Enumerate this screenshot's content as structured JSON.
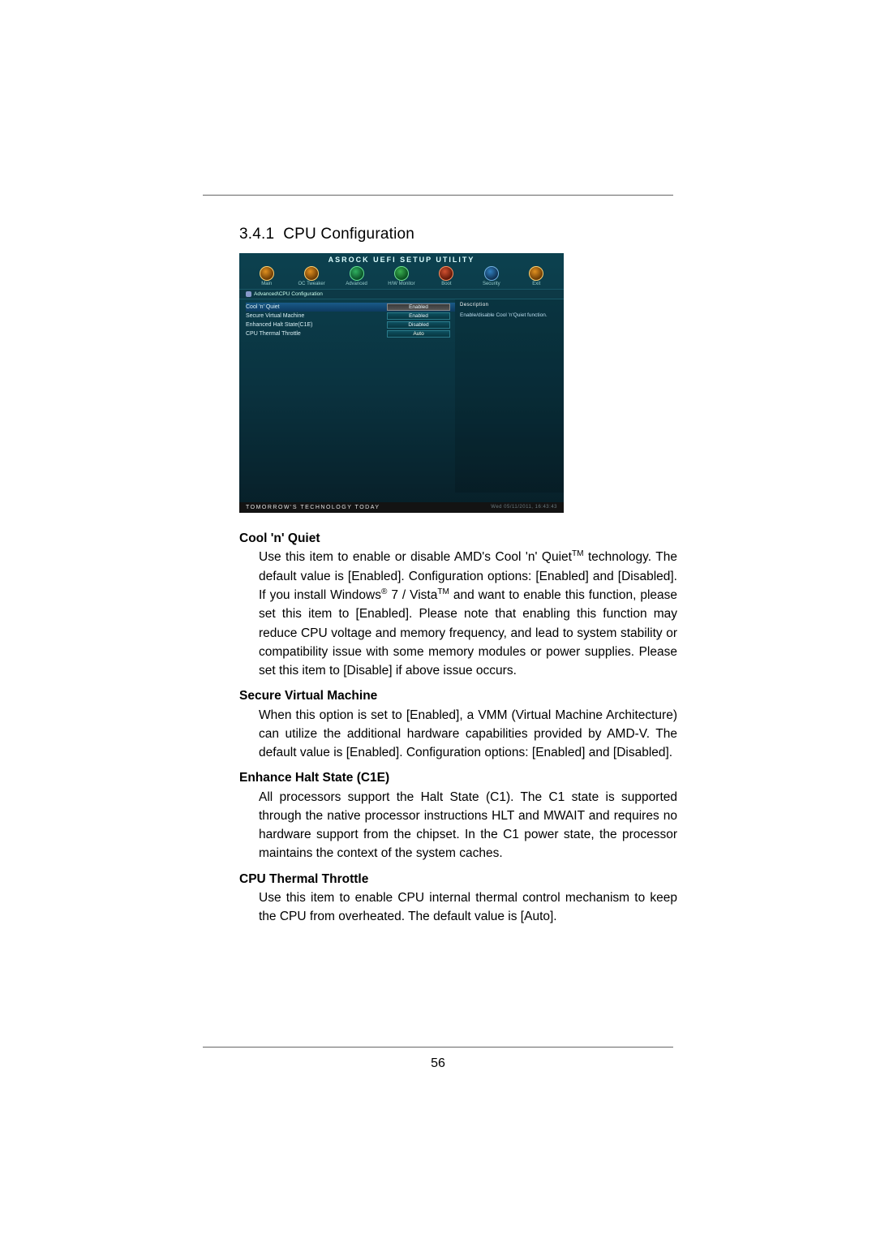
{
  "section_number": "3.4.1",
  "section_title": "CPU Configuration",
  "page_number": "56",
  "bios": {
    "title": "ASROCK UEFI SETUP UTILITY",
    "tabs": [
      {
        "label": "Main"
      },
      {
        "label": "OC Tweaker"
      },
      {
        "label": "Advanced"
      },
      {
        "label": "H/W Monitor"
      },
      {
        "label": "Boot"
      },
      {
        "label": "Security"
      },
      {
        "label": "Exit"
      }
    ],
    "breadcrumb": "Advanced\\CPU Configuration",
    "rows": [
      {
        "label": "Cool 'n' Quiet",
        "value": "Enabled",
        "selected": true
      },
      {
        "label": "Secure Virtual Machine",
        "value": "Enabled",
        "selected": false
      },
      {
        "label": "Enhanced Halt State(C1E)",
        "value": "Disabled",
        "selected": false
      },
      {
        "label": "CPU Thermal Throttle",
        "value": "Auto",
        "selected": false
      }
    ],
    "help_head": "Description",
    "help_text": "Enable/disable Cool 'n'Quiet function.",
    "footer_left": "TOMORROW'S TECHNOLOGY TODAY",
    "footer_right": "Wed 05/11/2011, 16:43:43"
  },
  "items": [
    {
      "title": "Cool 'n' Quiet",
      "body_parts": [
        "Use this item to enable or disable AMD's Cool 'n' Quiet",
        "TM",
        " technology. The default value is [Enabled]. Configuration options: [Enabled] and [Disabled]. If you install Windows",
        "®",
        " 7 / Vista",
        "TM",
        " and want to enable this function, please set this item to [Enabled]. Please note that enabling this function may reduce CPU voltage and memory frequency, and lead to system stability or compatibility issue with some memory modules or power supplies. Please set this item to [Disable] if above issue occurs."
      ]
    },
    {
      "title": "Secure Virtual Machine",
      "body": " When this option is set to [Enabled], a VMM (Virtual Machine Architecture) can utilize the additional hardware capabilities provided by AMD-V. The default value is [Enabled]. Configuration options: [Enabled] and [Disabled]."
    },
    {
      "title": "Enhance Halt State (C1E)",
      "body": "All processors support the Halt State (C1). The C1 state is supported through the native processor instructions HLT and MWAIT and requires no hardware support from the chipset. In the C1 power state, the processor maintains the context of the system caches."
    },
    {
      "title": "CPU Thermal Throttle",
      "body": "Use this item to enable CPU internal thermal control mechanism to keep the CPU from overheated. The default value is [Auto]."
    }
  ]
}
